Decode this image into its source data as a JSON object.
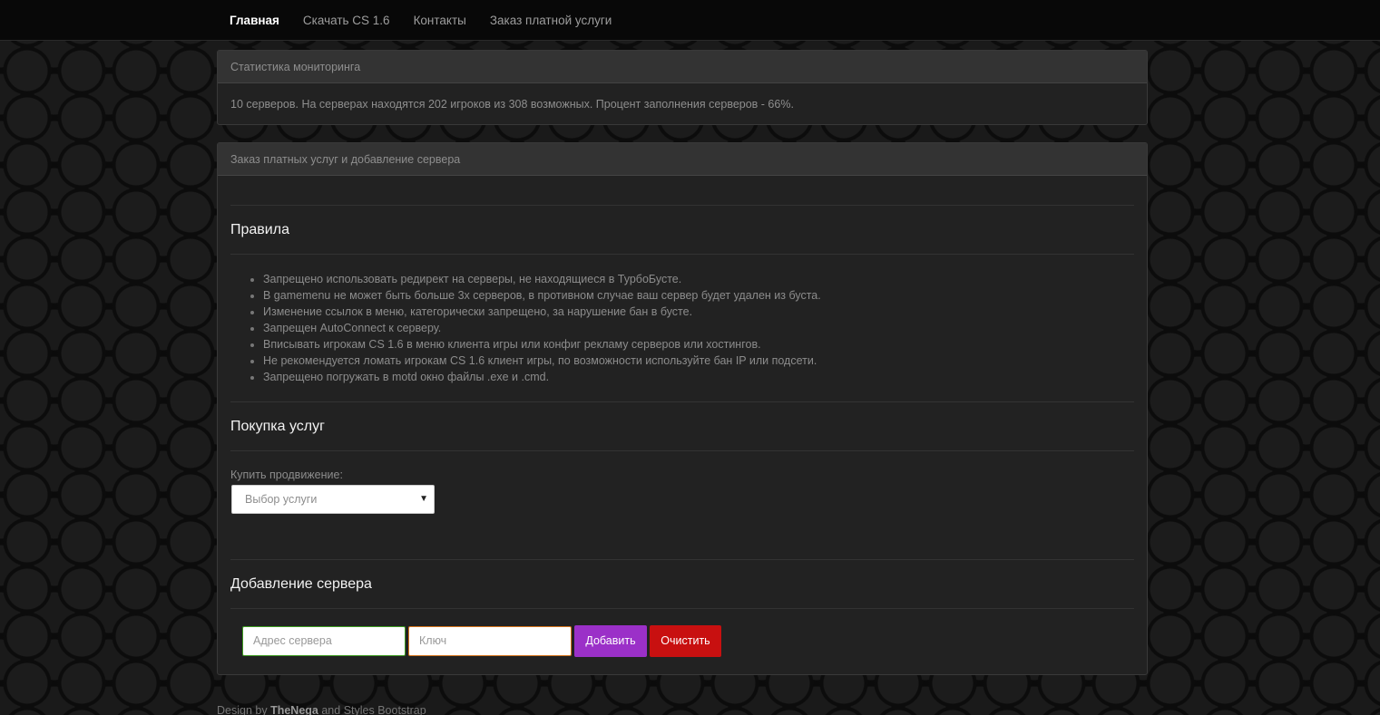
{
  "nav": {
    "items": [
      {
        "label": "Главная",
        "active": true
      },
      {
        "label": "Скачать CS 1.6",
        "active": false
      },
      {
        "label": "Контакты",
        "active": false
      },
      {
        "label": "Заказ платной услуги",
        "active": false
      }
    ]
  },
  "stats": {
    "title": "Статистика мониторинга",
    "text": "10 серверов. На серверах находятся 202 игроков из 308 возможных. Процент заполнения серверов - 66%."
  },
  "order": {
    "title": "Заказ платных услуг и добавление сервера",
    "rules_heading": "Правила",
    "rules": [
      "Запрещено использовать редирект на серверы, не находящиеся в ТурбоБусте.",
      "В gamemenu не может быть больше 3х серверов, в противном случае ваш сервер будет удален из буста.",
      "Изменение ссылок в меню, категорически запрещено, за нарушение бан в бусте.",
      "Запрещен AutoConnect к серверу.",
      "Вписывать игрокам CS 1.6 в меню клиента игры или конфиг рекламу серверов или хостингов.",
      "Не рекомендуется ломать игрокам CS 1.6 клиент игры, по возможности используйте бан IP или подсети.",
      "Запрещено погружать в motd окно файлы .exe и .cmd."
    ],
    "buy_heading": "Покупка услуг",
    "buy_label": "Купить продвижение:",
    "service_select": "Выбор услуги",
    "add_heading": "Добавление сервера",
    "address_placeholder": "Адрес сервера",
    "key_placeholder": "Ключ",
    "add_button": "Добавить",
    "clear_button": "Очистить"
  },
  "footer": {
    "prefix": "Design by",
    "author": "TheNega",
    "suffix": "and Styles Bootstrap"
  },
  "colors": {
    "add_button": "#9b30c8",
    "clear_button": "#c81010",
    "address_border": "#3c9a1f",
    "key_border": "#d4731a"
  }
}
